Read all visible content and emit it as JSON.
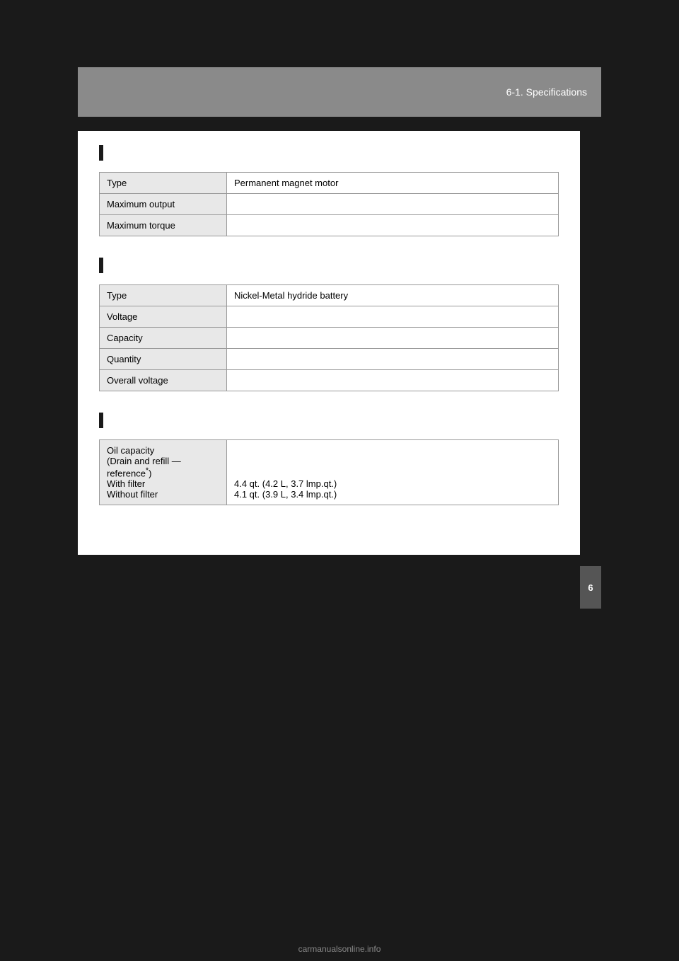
{
  "page": {
    "background_color": "#1a1a1a",
    "header": {
      "section_number": "6-1. Specifications"
    },
    "side_tab": {
      "label": "6"
    },
    "bottom_logo": "carmanualsonline.info"
  },
  "sections": [
    {
      "id": "electric_motor",
      "bar_label": "",
      "table_rows": [
        {
          "label": "Type",
          "value": "Permanent magnet motor"
        },
        {
          "label": "Maximum output",
          "value": ""
        },
        {
          "label": "Maximum torque",
          "value": ""
        }
      ]
    },
    {
      "id": "hv_battery",
      "bar_label": "",
      "table_rows": [
        {
          "label": "Type",
          "value": "Nickel-Metal hydride battery"
        },
        {
          "label": "Voltage",
          "value": ""
        },
        {
          "label": "Capacity",
          "value": ""
        },
        {
          "label": "Quantity",
          "value": ""
        },
        {
          "label": "Overall voltage",
          "value": ""
        }
      ]
    },
    {
      "id": "engine_oil",
      "bar_label": "",
      "table_rows": [
        {
          "label": "Oil capacity\n(Drain and refill —\nreference*)\nWith filter\nWithout filter",
          "label_lines": [
            "Oil capacity",
            "(Drain and refill —",
            "reference*)",
            "With filter",
            "Without filter"
          ],
          "value_lines": [
            "",
            "",
            "",
            "4.4 qt. (4.2 L, 3.7 lmp.qt.)",
            "4.1 qt. (3.9 L, 3.4 lmp.qt.)"
          ]
        }
      ]
    }
  ]
}
